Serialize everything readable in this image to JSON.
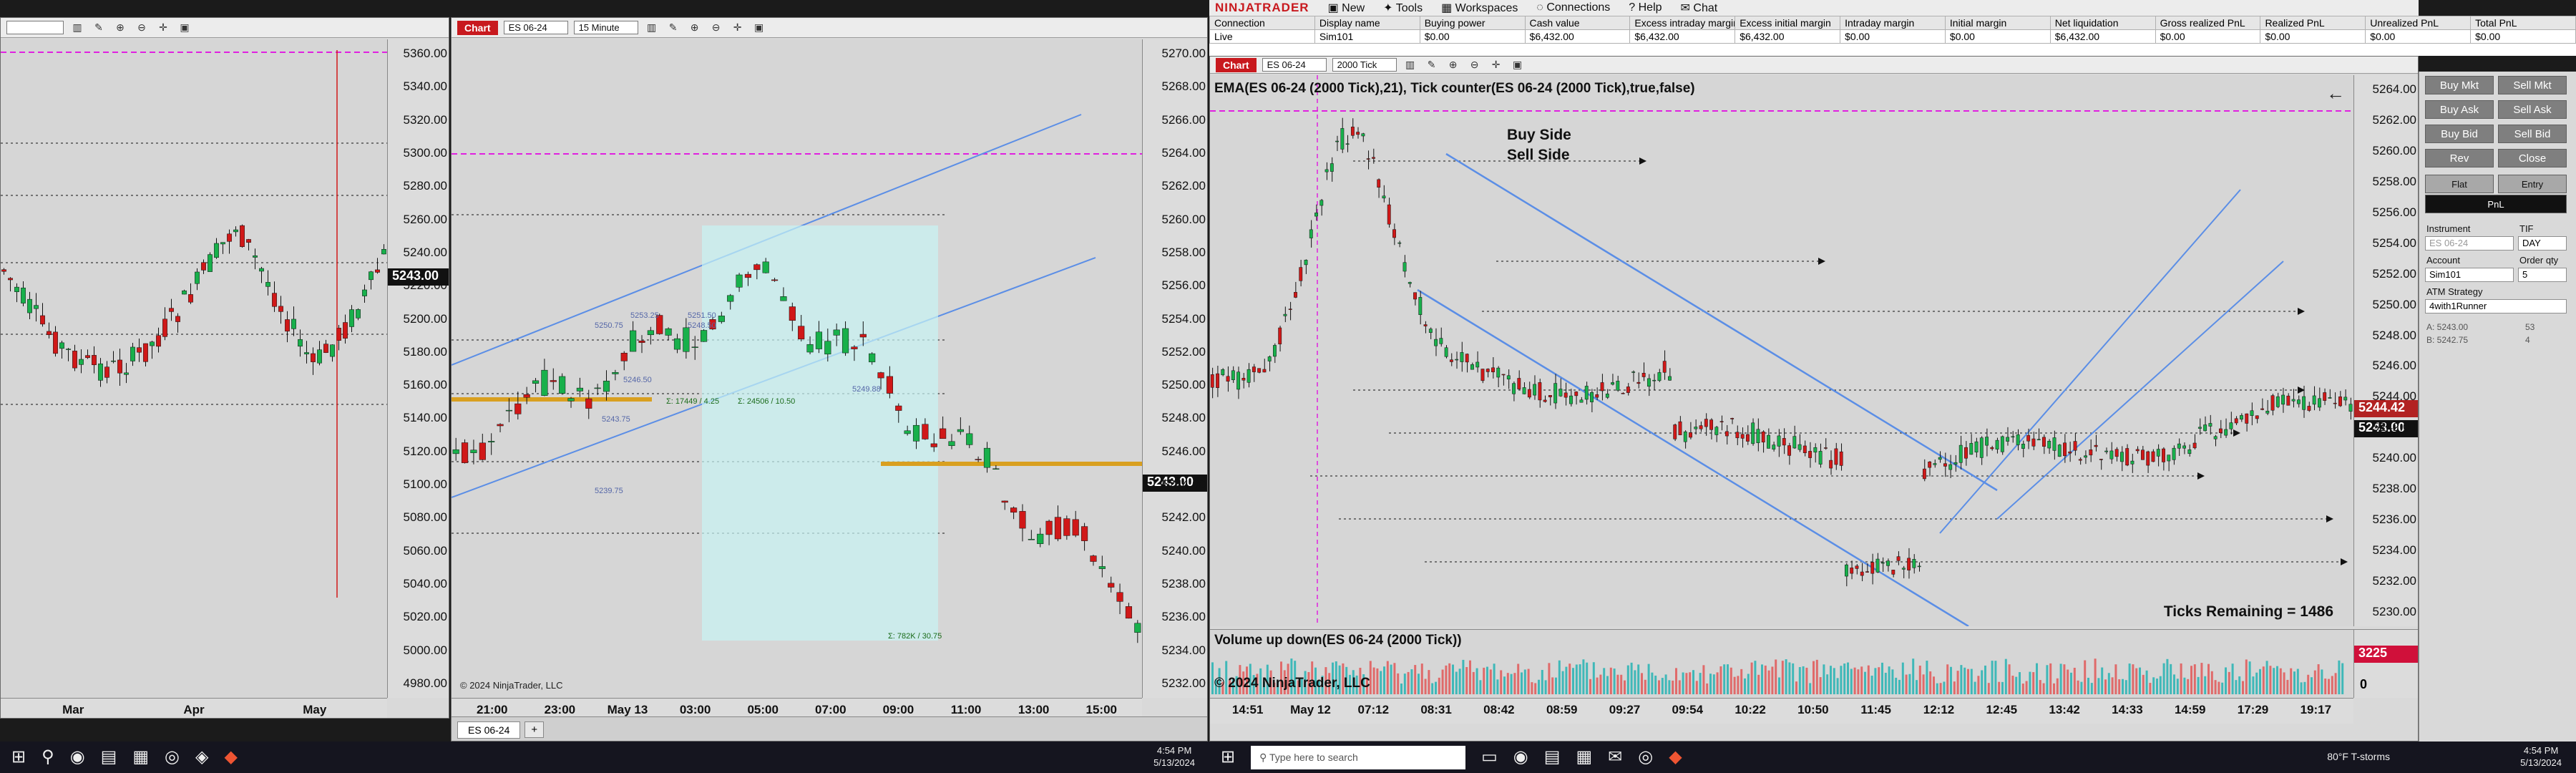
{
  "monitor1": {
    "left_chart": {
      "y_ticks": [
        "5360.00",
        "5340.00",
        "5320.00",
        "5300.00",
        "5280.00",
        "5260.00",
        "5240.00",
        "5220.00",
        "5200.00",
        "5180.00",
        "5160.00",
        "5140.00",
        "5120.00",
        "5100.00",
        "5080.00",
        "5060.00",
        "5040.00",
        "5020.00",
        "5000.00",
        "4980.00"
      ],
      "x_ticks": [
        "Mar",
        "Apr",
        "May"
      ],
      "price_tag": "5243.00"
    },
    "mid_chart": {
      "chart_label": "Chart",
      "instrument": "ES 06-24",
      "interval": "15 Minute",
      "tab_label": "ES 06-24",
      "add_tab": "+",
      "y_ticks": [
        "5270.00",
        "5268.00",
        "5266.00",
        "5264.00",
        "5262.00",
        "5260.00",
        "5258.00",
        "5256.00",
        "5254.00",
        "5252.00",
        "5250.00",
        "5248.00",
        "5246.00",
        "5244.00",
        "5242.00",
        "5240.00",
        "5238.00",
        "5236.00",
        "5234.00",
        "5232.00"
      ],
      "x_ticks": [
        "21:00",
        "23:00",
        "May 13",
        "03:00",
        "05:00",
        "07:00",
        "09:00",
        "11:00",
        "13:00",
        "15:00"
      ],
      "price_tag": "5243.00",
      "copyright": "© 2024 NinjaTrader, LLC",
      "profile_labels": [
        "5253.25",
        "5251.50",
        "5250.75",
        "5248.50",
        "5246.50",
        "5243.75",
        "5239.75",
        "5249.88"
      ],
      "annotations": [
        "Σ: 17449 / 4.25",
        "Σ: 24506 / 10.50",
        "Σ: 782K / 30.75"
      ]
    },
    "taskbar": {
      "time": "4:54 PM",
      "date": "5/13/2024"
    }
  },
  "monitor2": {
    "menu": {
      "logo": "NINJATRADER",
      "items": [
        "New",
        "Tools",
        "Workspaces",
        "Connections",
        "Help",
        "Chat"
      ]
    },
    "account_table": {
      "headers": [
        "Connection",
        "Display name",
        "Buying power",
        "Cash value",
        "Excess intraday margin",
        "Excess initial margin",
        "Intraday margin",
        "Initial margin",
        "Net liquidation",
        "Gross realized PnL",
        "Realized PnL",
        "Unrealized PnL",
        "Total PnL"
      ],
      "row": [
        "Live",
        "Sim101",
        "$0.00",
        "$6,432.00",
        "$6,432.00",
        "$6,432.00",
        "$0.00",
        "$0.00",
        "$6,432.00",
        "$0.00",
        "$0.00",
        "$0.00",
        "$0.00"
      ]
    },
    "main_chart": {
      "chart_label": "Chart",
      "instrument": "ES 06-24",
      "interval": "2000 Tick",
      "indicator_label": "EMA(ES 06-24 (2000 Tick),21), Tick counter(ES 06-24 (2000 Tick),true,false)",
      "buy_side": "Buy Side",
      "sell_side": "Sell Side",
      "ticks_remaining": "Ticks Remaining = 1486",
      "y_ticks": [
        "5264.00",
        "5262.00",
        "5260.00",
        "5258.00",
        "5256.00",
        "5254.00",
        "5252.00",
        "5250.00",
        "5248.00",
        "5246.00",
        "5244.00",
        "5242.00",
        "5240.00",
        "5238.00",
        "5236.00",
        "5234.00",
        "5232.00",
        "5230.00"
      ],
      "price_tag_1": "5244.42",
      "price_tag_2": "5243.00",
      "volume_label": "Volume up down(ES 06-24 (2000 Tick))",
      "copyright": "© 2024 NinjaTrader, LLC",
      "volume_tag": "3225",
      "volume_zero": "0",
      "x_ticks": [
        "14:51",
        "May 12",
        "07:12",
        "08:31",
        "08:42",
        "08:59",
        "09:27",
        "09:54",
        "10:22",
        "10:50",
        "11:45",
        "12:12",
        "12:45",
        "13:42",
        "14:33",
        "14:59",
        "17:29",
        "19:17"
      ]
    },
    "order_panel": {
      "buttons": [
        "Buy Mkt",
        "Sell Mkt",
        "Buy Ask",
        "Sell Ask",
        "Buy Bid",
        "Sell Bid",
        "Rev",
        "Close"
      ],
      "flat": "Flat",
      "entry": "Entry",
      "pnl": "PnL",
      "instrument_label": "Instrument",
      "instrument_value": "ES 06-24",
      "tif_label": "TIF",
      "tif_value": "DAY",
      "account_label": "Account",
      "account_value": "Sim101",
      "qty_label": "Order qty",
      "qty_value": "5",
      "atm_label": "ATM Strategy",
      "atm_value": "4with1Runner",
      "ask_line": "A:  5243.00",
      "ask_qty": "53",
      "bid_line": "B:  5242.75",
      "bid_qty": "4"
    },
    "taskbar": {
      "search_placeholder": "Type here to search",
      "weather": "80°F  T-storms",
      "time": "4:54 PM",
      "date": "5/13/2024"
    }
  }
}
